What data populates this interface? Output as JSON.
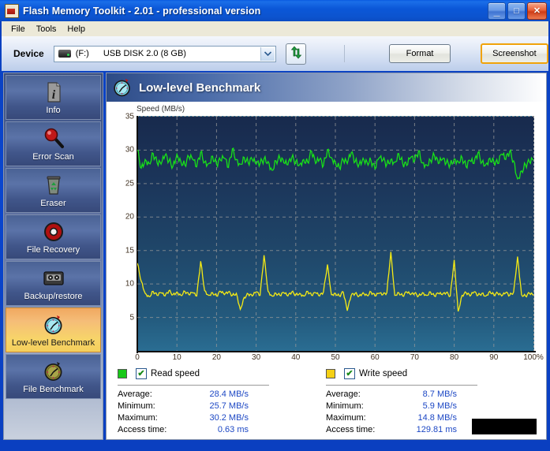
{
  "window": {
    "title": "Flash Memory Toolkit - 2.01 - professional version",
    "title_icon": "app-flash-icon",
    "minimize_glyph": "_",
    "maximize_glyph": "□",
    "close_glyph": "✕"
  },
  "menu": {
    "items": [
      {
        "label": "File"
      },
      {
        "label": "Tools"
      },
      {
        "label": "Help"
      }
    ]
  },
  "toolbar": {
    "device_label": "Device",
    "device_icon": "usb-drive-icon",
    "device_drive": "(F:)",
    "device_name": "USB DISK 2.0 (8 GB)",
    "dropdown_glyph": "❯",
    "refresh_icon": "refresh-arrows-icon",
    "format_label": "Format",
    "screenshot_label": "Screenshot"
  },
  "sidebar": {
    "items": [
      {
        "label": "Info",
        "icon": "info-document-icon",
        "active": false
      },
      {
        "label": "Error Scan",
        "icon": "magnifier-icon",
        "active": false
      },
      {
        "label": "Eraser",
        "icon": "recycle-bin-icon",
        "active": false
      },
      {
        "label": "File Recovery",
        "icon": "lifering-icon",
        "active": false
      },
      {
        "label": "Backup/restore",
        "icon": "cassette-tape-icon",
        "active": false
      },
      {
        "label": "Low-level Benchmark",
        "icon": "stopwatch-blue-icon",
        "active": true
      },
      {
        "label": "File Benchmark",
        "icon": "stopwatch-olive-icon",
        "active": false
      }
    ]
  },
  "content": {
    "header_title": "Low-level Benchmark",
    "header_icon": "stopwatch-blue-icon"
  },
  "chart_data": {
    "type": "line",
    "title": "",
    "ylabel": "Speed (MB/s)",
    "xlabel": "",
    "ylim": [
      0,
      35
    ],
    "xlim": [
      0,
      100
    ],
    "yticks": [
      5,
      10,
      15,
      20,
      25,
      30,
      35
    ],
    "xticks": [
      "0",
      "10",
      "20",
      "30",
      "40",
      "50",
      "60",
      "70",
      "80",
      "90",
      "100%"
    ],
    "grid": true,
    "legend_position": "below",
    "plot_bg_top": "#182a4d",
    "plot_bg_bottom": "#2a6d92",
    "series": [
      {
        "name": "Read speed",
        "color": "#18e018",
        "x": [
          0,
          1,
          2,
          3,
          4,
          5,
          6,
          7,
          8,
          9,
          10,
          11,
          12,
          13,
          14,
          15,
          16,
          17,
          18,
          19,
          20,
          21,
          22,
          23,
          24,
          25,
          26,
          27,
          28,
          29,
          30,
          31,
          32,
          33,
          34,
          35,
          36,
          37,
          38,
          39,
          40,
          41,
          42,
          43,
          44,
          45,
          46,
          47,
          48,
          49,
          50,
          51,
          52,
          53,
          54,
          55,
          56,
          57,
          58,
          59,
          60,
          61,
          62,
          63,
          64,
          65,
          66,
          67,
          68,
          69,
          70,
          71,
          72,
          73,
          74,
          75,
          76,
          77,
          78,
          79,
          80,
          81,
          82,
          83,
          84,
          85,
          86,
          87,
          88,
          89,
          90,
          91,
          92,
          93,
          94,
          95,
          96,
          97,
          98,
          99,
          100
        ],
        "y": [
          30.0,
          27.3,
          28.6,
          28.0,
          29.5,
          28.1,
          27.9,
          29.2,
          28.4,
          27.6,
          29.4,
          28.3,
          27.8,
          29.0,
          28.6,
          27.5,
          29.7,
          28.2,
          28.0,
          29.1,
          27.9,
          28.5,
          28.8,
          27.4,
          30.2,
          28.6,
          27.9,
          28.9,
          28.1,
          28.6,
          27.9,
          28.0,
          28.7,
          28.3,
          27.0,
          28.4,
          28.8,
          28.1,
          27.8,
          28.9,
          28.3,
          27.9,
          28.6,
          28.2,
          29.8,
          28.0,
          28.6,
          27.7,
          30.1,
          28.9,
          28.2,
          27.4,
          28.5,
          28.0,
          29.6,
          28.3,
          27.9,
          28.8,
          28.2,
          28.4,
          27.2,
          28.8,
          28.5,
          27.9,
          28.6,
          28.2,
          29.5,
          28.0,
          27.7,
          28.9,
          28.4,
          29.9,
          28.1,
          27.8,
          28.5,
          29.2,
          28.0,
          28.6,
          28.1,
          27.9,
          28.7,
          28.3,
          28.9,
          27.5,
          28.4,
          28.0,
          29.6,
          28.2,
          27.9,
          28.8,
          28.3,
          28.0,
          29.4,
          28.6,
          29.8,
          28.4,
          25.7,
          26.9,
          27.8,
          28.2,
          28.5
        ]
      },
      {
        "name": "Write speed",
        "color": "#f5ea14",
        "x": [
          0,
          1,
          2,
          3,
          4,
          5,
          6,
          7,
          8,
          9,
          10,
          11,
          12,
          13,
          14,
          15,
          16,
          17,
          18,
          19,
          20,
          21,
          22,
          23,
          24,
          25,
          26,
          27,
          28,
          29,
          30,
          31,
          32,
          33,
          34,
          35,
          36,
          37,
          38,
          39,
          40,
          41,
          42,
          43,
          44,
          45,
          46,
          47,
          48,
          49,
          50,
          51,
          52,
          53,
          54,
          55,
          56,
          57,
          58,
          59,
          60,
          61,
          62,
          63,
          64,
          65,
          66,
          67,
          68,
          69,
          70,
          71,
          72,
          73,
          74,
          75,
          76,
          77,
          78,
          79,
          80,
          81,
          82,
          83,
          84,
          85,
          86,
          87,
          88,
          89,
          90,
          91,
          92,
          93,
          94,
          95,
          96,
          97,
          98,
          99,
          100
        ],
        "y": [
          13.1,
          10.4,
          8.6,
          8.1,
          8.9,
          8.3,
          8.7,
          8.2,
          9.0,
          8.4,
          8.8,
          8.3,
          8.9,
          8.4,
          8.7,
          8.2,
          13.4,
          9.0,
          8.3,
          8.7,
          8.2,
          8.9,
          8.4,
          8.8,
          8.3,
          8.6,
          6.2,
          8.0,
          8.5,
          8.2,
          8.8,
          8.3,
          14.3,
          8.9,
          8.2,
          8.6,
          8.3,
          8.7,
          8.2,
          8.8,
          8.4,
          8.6,
          8.2,
          8.9,
          8.3,
          8.7,
          8.2,
          8.8,
          12.9,
          8.4,
          8.6,
          8.2,
          8.8,
          6.0,
          8.3,
          8.6,
          8.2,
          8.7,
          8.3,
          8.8,
          8.2,
          8.6,
          8.4,
          8.7,
          14.8,
          8.3,
          8.7,
          8.2,
          8.8,
          8.4,
          8.6,
          8.2,
          8.7,
          8.3,
          8.8,
          8.2,
          8.6,
          8.4,
          8.7,
          8.2,
          13.6,
          5.9,
          8.3,
          8.7,
          8.2,
          8.8,
          8.3,
          8.6,
          8.2,
          8.9,
          8.4,
          8.6,
          8.2,
          8.7,
          8.3,
          8.8,
          14.1,
          8.4,
          8.2,
          8.6,
          8.3
        ]
      }
    ]
  },
  "stats": {
    "read": {
      "legend_label": "Read speed",
      "swatch_color": "#18c818",
      "checked_glyph": "✔",
      "rows": [
        {
          "key": "Average:",
          "value": "28.4 MB/s"
        },
        {
          "key": "Minimum:",
          "value": "25.7 MB/s"
        },
        {
          "key": "Maximum:",
          "value": "30.2 MB/s"
        },
        {
          "key": "Access time:",
          "value": "0.63 ms"
        }
      ]
    },
    "write": {
      "legend_label": "Write speed",
      "swatch_color": "#f5d014",
      "checked_glyph": "✔",
      "rows": [
        {
          "key": "Average:",
          "value": "8.7 MB/s"
        },
        {
          "key": "Minimum:",
          "value": "5.9 MB/s"
        },
        {
          "key": "Maximum:",
          "value": "14.8 MB/s"
        },
        {
          "key": "Access time:",
          "value": "129.81 ms"
        }
      ]
    }
  }
}
